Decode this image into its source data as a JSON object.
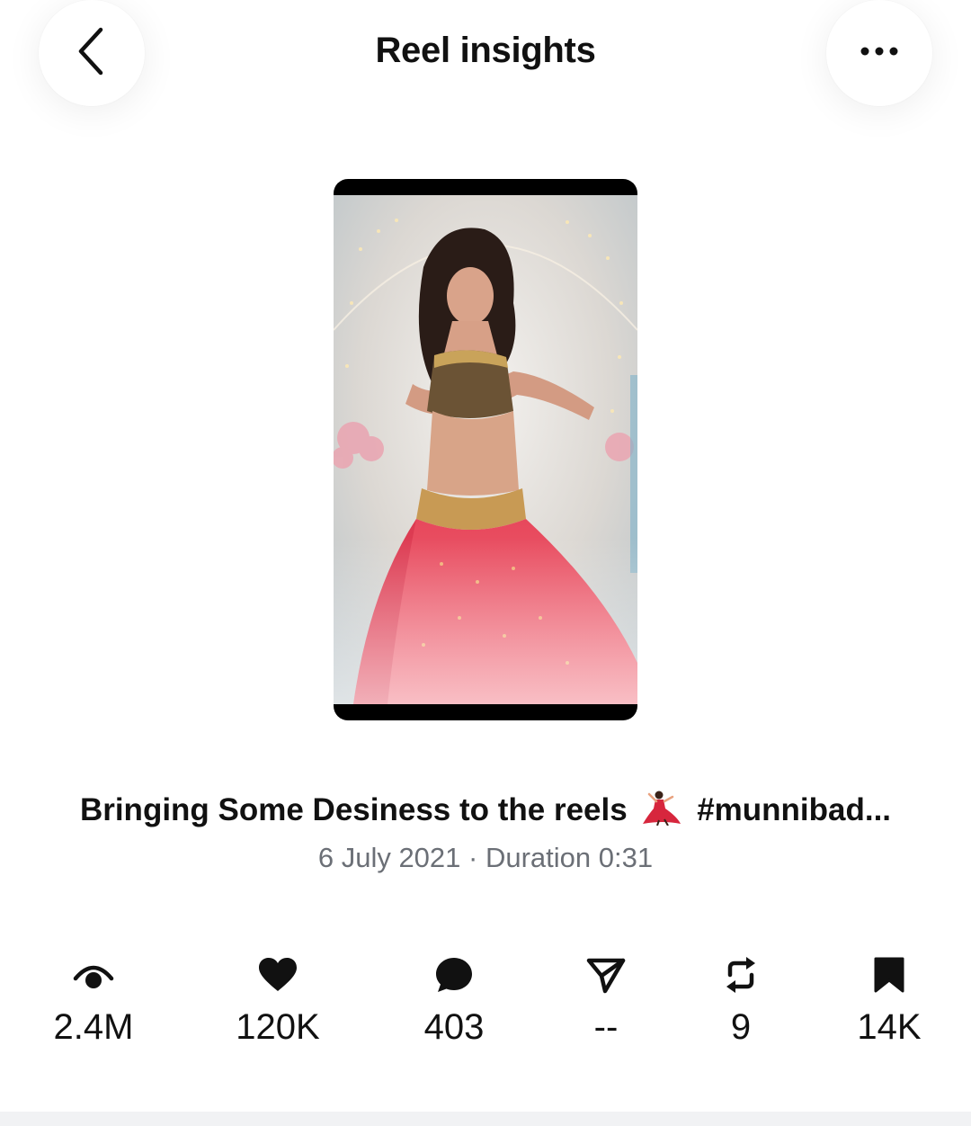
{
  "header": {
    "title": "Reel insights",
    "back_icon": "chevron-left-icon",
    "more_icon": "more-horizontal-icon"
  },
  "reel": {
    "caption_text": "Bringing Some Desiness to the reels",
    "caption_emoji": "woman-dancing-emoji",
    "caption_hashtag": "#munnibad...",
    "date": "6 July 2021",
    "separator": "·",
    "duration_label": "Duration",
    "duration": "0:31"
  },
  "stats": [
    {
      "icon": "eye-icon",
      "value": "2.4M"
    },
    {
      "icon": "heart-icon",
      "value": "120K"
    },
    {
      "icon": "comment-icon",
      "value": "403"
    },
    {
      "icon": "send-icon",
      "value": "--"
    },
    {
      "icon": "repost-icon",
      "value": "9"
    },
    {
      "icon": "bookmark-icon",
      "value": "14K"
    }
  ],
  "colors": {
    "text": "#111111",
    "muted": "#6b6f76",
    "skirt": "#e0384d",
    "background": "#ffffff"
  }
}
